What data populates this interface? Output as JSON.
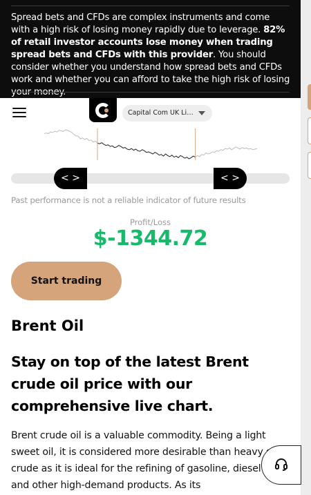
{
  "risk_warning": {
    "text_before": "Spread bets and CFDs are complex instruments and come with a high risk of losing money rapidly due to leverage. ",
    "text_bold": "82% of retail investor accounts lose money when trading spread bets and CFDs with this provider",
    "text_after": ". You should consider whether you understand how spread bets and CFDs work and whether you can afford to take the high risk of losing your money."
  },
  "header": {
    "entity_selector": "Capital Com UK Limited"
  },
  "chart_data": {
    "type": "line",
    "title": "",
    "xlabel": "",
    "ylabel": "",
    "x": [
      0,
      1,
      2,
      3,
      4,
      5,
      6,
      7,
      8,
      9,
      10,
      11,
      12,
      13,
      14,
      15,
      16,
      17,
      18,
      19,
      20,
      21,
      22,
      23,
      24,
      25,
      26,
      27,
      28,
      29,
      30,
      31,
      32,
      33,
      34,
      35,
      36,
      37,
      38,
      39,
      40,
      41,
      42,
      43,
      44,
      45,
      46,
      47,
      48,
      49,
      50,
      51,
      52,
      53,
      54,
      55,
      56,
      57,
      58,
      59,
      60,
      61,
      62,
      63,
      64,
      65,
      66,
      67,
      68,
      69,
      70,
      71,
      72,
      73,
      74,
      75,
      76,
      77,
      78,
      79,
      80,
      81,
      82,
      83,
      84,
      85,
      86,
      87,
      88,
      89,
      90,
      91,
      92,
      93,
      94,
      95,
      96,
      97,
      98,
      99,
      100
    ],
    "values": [
      60,
      61,
      60,
      63,
      62,
      64,
      63,
      66,
      65,
      64,
      67,
      66,
      64,
      62,
      58,
      56,
      55,
      50,
      52,
      49,
      51,
      47,
      48,
      44,
      46,
      42,
      41,
      43,
      40,
      38,
      39,
      36,
      37,
      34,
      35,
      38,
      36,
      33,
      34,
      31,
      30,
      32,
      29,
      31,
      28,
      27,
      30,
      28,
      25,
      26,
      24,
      22,
      25,
      23,
      20,
      21,
      18,
      22,
      19,
      17,
      20,
      16,
      18,
      15,
      19,
      17,
      14,
      16,
      13,
      15,
      18,
      16,
      19,
      17,
      21,
      20,
      24,
      22,
      23,
      26,
      25,
      28,
      27,
      30,
      29,
      32,
      31,
      33,
      30,
      32,
      35,
      33,
      31,
      34,
      32,
      33,
      31,
      32,
      30,
      31,
      32
    ],
    "window_selected": [
      25,
      71
    ],
    "grid": false,
    "legend": "none"
  },
  "range_slider": {
    "left_handle": "< >",
    "right_handle": "< >"
  },
  "disclaimer": "Past performance is not a reliable indicator of future results",
  "profit_loss": {
    "label": "Profit/Loss",
    "value": "$-1344.72"
  },
  "cta": {
    "label": "Start trading"
  },
  "content": {
    "heading": "Brent Oil",
    "subheading": "Stay on top of the latest Brent crude oil price with our comprehensive live chart.",
    "paragraph": "Brent crude oil is a valuable commodity. Being a light sweet oil, it is considered more desirable than heavy sour crude as it is ideal for the refining of gasoline, diesel fuel and other high-demand products. As its"
  },
  "colors": {
    "accent": "#d6a47a",
    "profit_text": "#17b96b",
    "banner_bg": "#0d0d0d"
  },
  "icons": {
    "menu": "hamburger-icon",
    "support": "headset-icon"
  }
}
